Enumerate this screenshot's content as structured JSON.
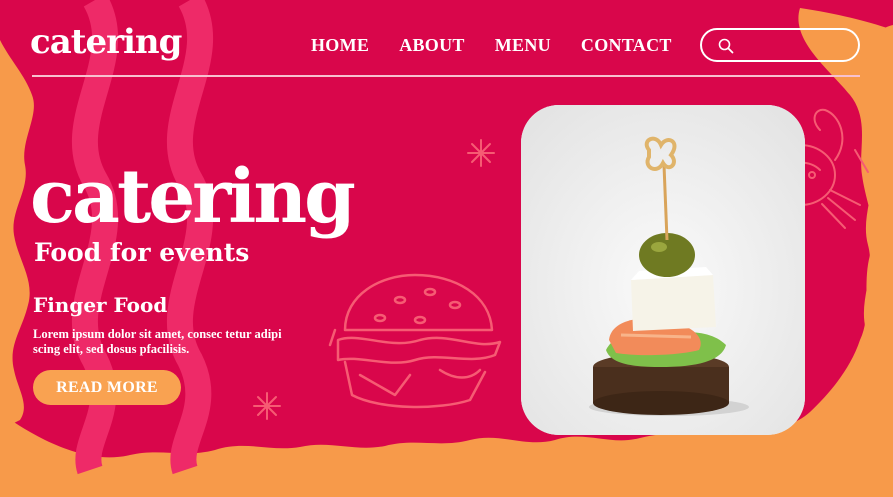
{
  "header": {
    "logo": "catering",
    "nav": [
      "HOME",
      "ABOUT",
      "MENU",
      "CONTACT"
    ],
    "search": {
      "placeholder": "",
      "icon": "search-icon"
    }
  },
  "hero": {
    "title": "catering",
    "subtitle": "Food for events"
  },
  "section": {
    "title": "Finger Food",
    "body": "Lorem ipsum dolor sit amet, consec tetur adipi scing elit, sed dosus pfacilisis.",
    "button_label": "READ MORE"
  },
  "colors": {
    "primary": "#d9064b",
    "accent": "#f79a4a",
    "stripe": "#f0286a",
    "outline": "#f65b73",
    "text": "#ffffff"
  },
  "illustrations": [
    "burger-illustration",
    "crab-illustration",
    "sparkle-icon",
    "canape-photo"
  ]
}
